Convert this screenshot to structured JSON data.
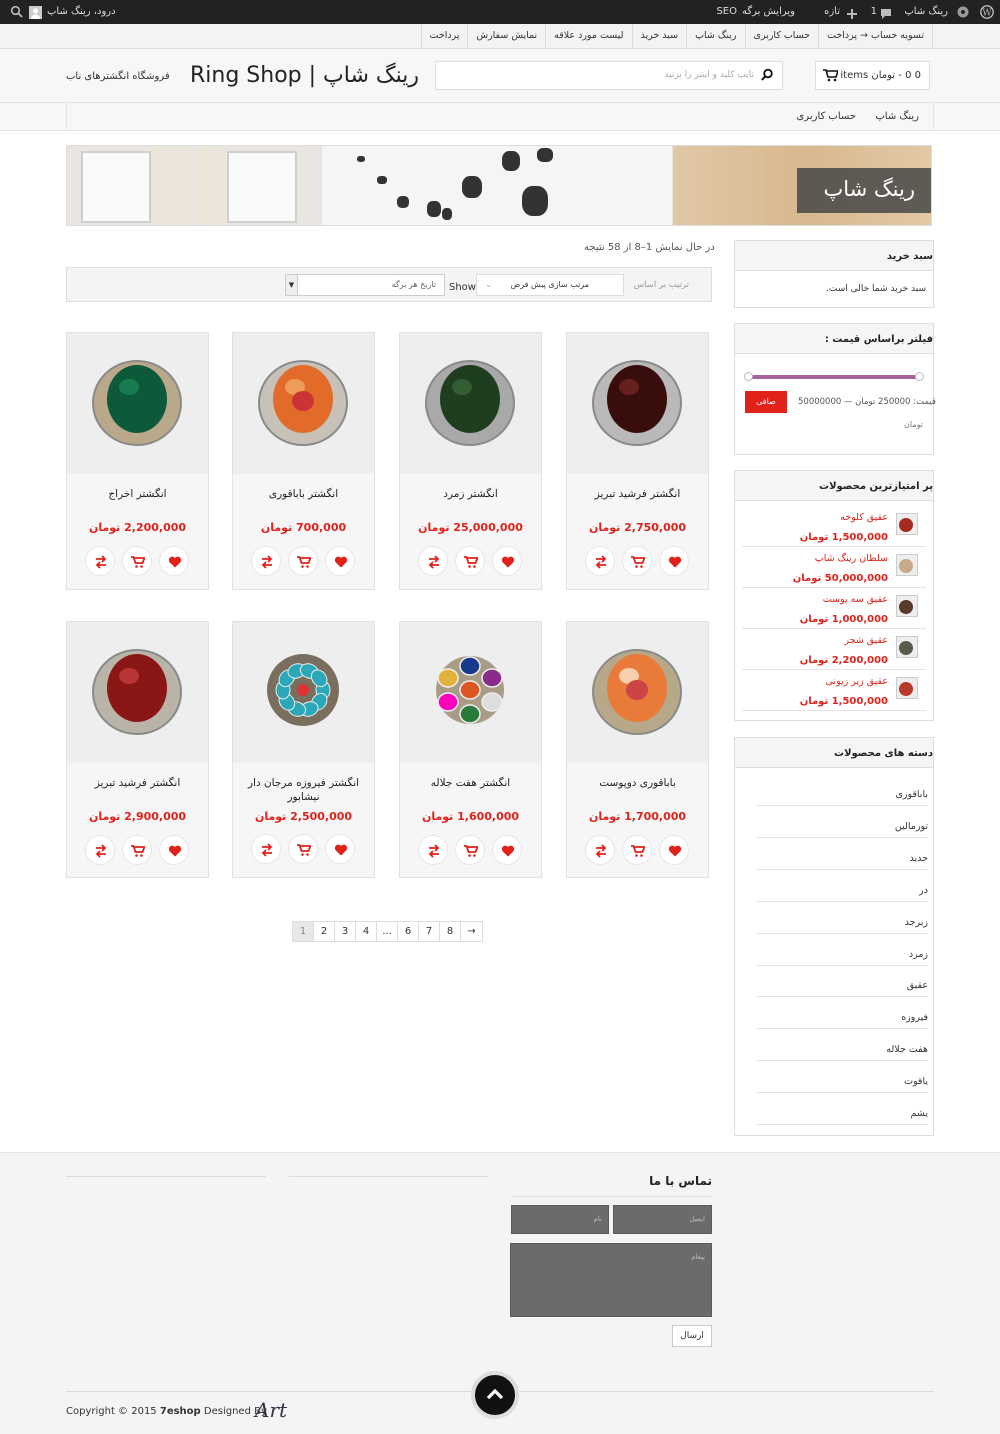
{
  "adminbar": {
    "site_name": "رینگ شاپ",
    "comments_count": "1",
    "new_label": "تازه",
    "edit_page": "ویرایش برگه",
    "seo": "SEO",
    "greeting": "درود، رینگ شاپ"
  },
  "topnav": {
    "items": [
      "تسویه حساب → پرداخت",
      "حساب کاربری",
      "رینگ شاپ",
      "سبد خرید",
      "لیست مورد علاقه",
      "نمایش سفارش",
      "پرداخت"
    ]
  },
  "header": {
    "title": "Ring Shop | رینگ شاپ",
    "subtitle": "فروشگاه انگشترهای ناب",
    "search_placeholder": "تایپ کلید و اینتر را بزنید",
    "cart_text": "0 0 - تومان items"
  },
  "mainnav": {
    "items": [
      "رینگ شاپ",
      "حساب کاربری"
    ]
  },
  "banner": {
    "label": "رینگ شاپ"
  },
  "shop": {
    "result_count": "در حال نمایش 1–8 از 58 نتیجه",
    "sort_label": "ترتیب بر اساس",
    "sort_value": "مرتب سازی پیش فرض",
    "show_label": "Show",
    "show_value": "تاریخ هر برگه"
  },
  "products": [
    {
      "name": "انگشتر فرشید تبریز",
      "price": "2,750,000 تومان"
    },
    {
      "name": "انگشتر زمرد",
      "price": "25,000,000 تومان"
    },
    {
      "name": "انگشتر باباقوری",
      "price": "700,000 تومان"
    },
    {
      "name": "انگشتر اخراج",
      "price": "2,200,000 تومان"
    },
    {
      "name": "باباقوری دوپوست",
      "price": "1,700,000 تومان"
    },
    {
      "name": "انگشتر هفت جلاله",
      "price": "1,600,000 تومان"
    },
    {
      "name": "انگشتر فیروزه مرجان دار نیشابور",
      "price": "2,500,000 تومان"
    },
    {
      "name": "انگشتر فرشید تبریز",
      "price": "2,900,000 تومان"
    }
  ],
  "pagination": [
    "1",
    "2",
    "3",
    "4",
    "...",
    "6",
    "7",
    "8",
    "→"
  ],
  "sidebar": {
    "cart_title": "سبد خرید",
    "cart_empty": "سبد خرید شما خالی است.",
    "filter_title": "فیلتر براساس قیمت :",
    "filter_button": "صافی",
    "price_range": "قیمت: 250000 تومان — 50000000",
    "price_unit": "تومان",
    "price_min": 250000,
    "price_max": 50000000,
    "top_title": "پر امتیازترین محصولات",
    "top_products": [
      {
        "name": "عقیق کلوخه",
        "price": "1,500,000 تومان"
      },
      {
        "name": "سلطان رینگ شاپ",
        "price": "50,000,000 تومان"
      },
      {
        "name": "عقیق سه پوست",
        "price": "1,000,000 تومان"
      },
      {
        "name": "عقیق شجر",
        "price": "2,200,000 تومان"
      },
      {
        "name": "عقیق زیر زیونی",
        "price": "1,500,000 تومان"
      }
    ],
    "cat_title": "دسته های محصولات",
    "categories": [
      "باباقوری",
      "تورمالین",
      "حدید",
      "در",
      "زبرجد",
      "زمرد",
      "عقیق",
      "فیروزه",
      "هفت جلاله",
      "یاقوت",
      "یشم"
    ]
  },
  "footer": {
    "contact_title": "تماس با ما",
    "name_placeholder": "نام",
    "email_placeholder": "ایمیل",
    "message_placeholder": "پیغام",
    "send_label": "ارسال",
    "copyright": "Copyright © 2015",
    "brand": "7eshop",
    "designed_by": "Designed By"
  },
  "colors": {
    "accent": "#e0221a",
    "slider": "#a7649b",
    "adminbar": "#222222"
  }
}
